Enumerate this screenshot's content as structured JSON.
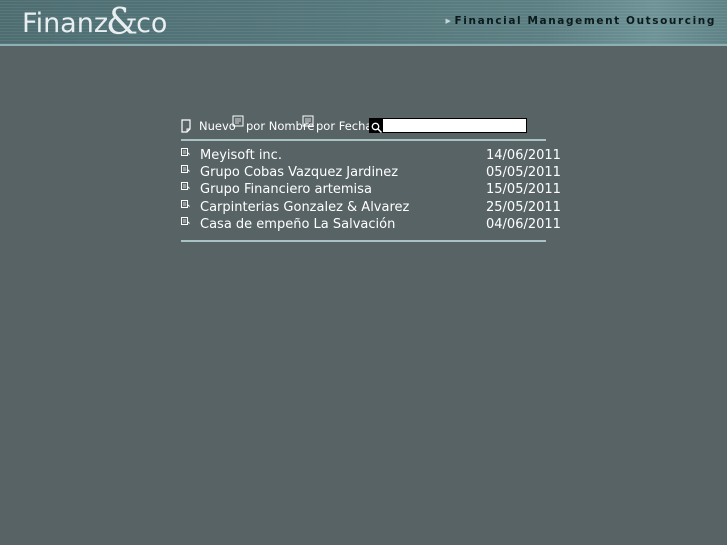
{
  "header": {
    "logo_text_left": "Finanz",
    "logo_text_amp": "&",
    "logo_text_right": "co",
    "tagline": "Financial Management Outsourcing"
  },
  "toolbar": {
    "new_label": "Nuevo",
    "by_name_label": "por Nombre",
    "by_date_label": "por Fecha",
    "search_value": ""
  },
  "clients": [
    {
      "name": "Meyisoft inc.",
      "date": "14/06/2011"
    },
    {
      "name": "Grupo Cobas Vazquez Jardinez",
      "date": "05/05/2011"
    },
    {
      "name": "Grupo Financiero artemisa",
      "date": "15/05/2011"
    },
    {
      "name": "Carpinterias Gonzalez & Alvarez",
      "date": "25/05/2011"
    },
    {
      "name": "Casa de empeño La Salvación",
      "date": "04/06/2011"
    }
  ],
  "colors": {
    "background": "#586366",
    "divider": "#a9c2c4",
    "text": "#ffffff"
  }
}
